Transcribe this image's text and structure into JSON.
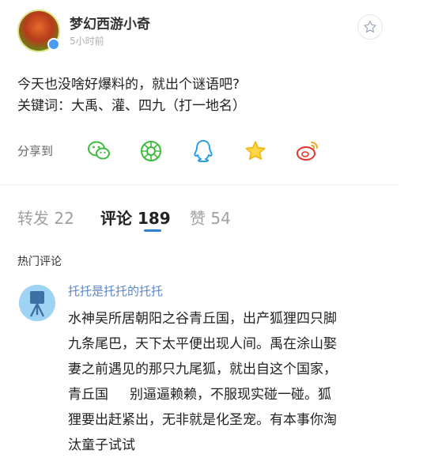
{
  "post": {
    "username": "梦幻西游小奇",
    "time": "5小时前",
    "text_line1": "今天也没啥好爆料的，就出个谜语吧?",
    "text_line2": "关键词：大禹、灌、四九（打一地名）"
  },
  "share": {
    "label": "分享到",
    "icons": [
      "wechat-icon",
      "moments-icon",
      "qq-icon",
      "qzone-star-icon",
      "weibo-icon"
    ],
    "colors": {
      "wechat": "#3dbb3d",
      "moments": "#3dbb3d",
      "qq": "#2aa0e8",
      "qzone": "#f5b50a",
      "weibo": "#e6322b"
    }
  },
  "tabs": {
    "repost": "转发 22",
    "comments": "评论 189",
    "likes": "赞 54"
  },
  "comments_section": {
    "title": "热门评论",
    "comment": {
      "author": "托托是托托的托托",
      "text": "水神吴所居朝阳之谷青丘国，出产狐狸四只脚\n九条尾巴，天下太平便出现人间。禹在涂山娶\n妻之前遇见的那只九尾狐，就出自这个国家，\n青丘国     别逼逼赖赖，不服现实碰一碰。狐\n狸要出赶紧出，无非就是化圣宠。有本事你淘\n汰童子试试"
    }
  },
  "accent_color": "#2f7fd6"
}
